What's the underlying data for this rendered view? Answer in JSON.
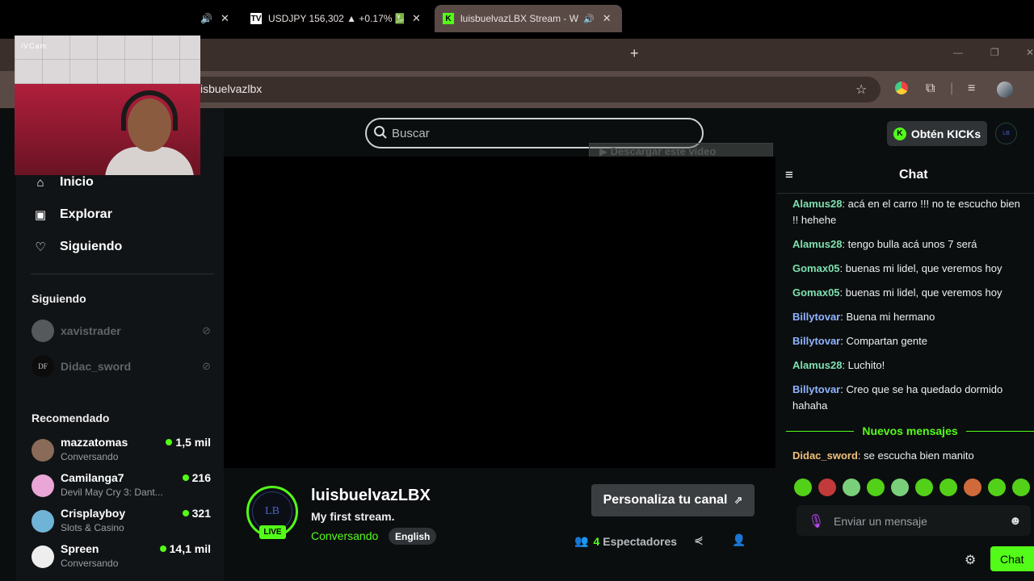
{
  "browser": {
    "tabs": [
      {
        "title": "USDJPY 156,302 ▲ +0.17% 💹",
        "favicon": "TV"
      },
      {
        "title": "luisbuelvazLBX Stream - Wa",
        "favicon": "K"
      }
    ],
    "address": "isbuelvazlbx"
  },
  "webcam": {
    "label": "iVCam"
  },
  "header": {
    "search_placeholder": "Buscar",
    "download_overlay": "▶ Descargar este video",
    "get_kicks": "Obtén KICKs"
  },
  "sidebar": {
    "nav": [
      {
        "label": "Inicio",
        "icon": "home-icon"
      },
      {
        "label": "Explorar",
        "icon": "browse-icon"
      },
      {
        "label": "Siguiendo",
        "icon": "heart-icon"
      }
    ],
    "following_title": "Siguiendo",
    "following": [
      {
        "name": "xavistrader"
      },
      {
        "name": "Didac_sword",
        "avatar_text": "DF"
      }
    ],
    "recommended_title": "Recomendado",
    "recommended": [
      {
        "name": "mazzatomas",
        "category": "Conversando",
        "viewers": "1,5 mil"
      },
      {
        "name": "Camilanga7",
        "category": "Devil May Cry 3: Dant...",
        "viewers": "216"
      },
      {
        "name": "Crisplayboy",
        "category": "Slots & Casino",
        "viewers": "321"
      },
      {
        "name": "Spreen",
        "category": "Conversando",
        "viewers": "14,1 mil"
      }
    ]
  },
  "channel": {
    "avatar_text": "LB",
    "live_badge": "LIVE",
    "name": "luisbuelvazLBX",
    "stream_title": "My first stream.",
    "category": "Conversando",
    "language": "English",
    "customize_label": "Personaliza tu canal",
    "viewer_count": "4",
    "viewers_label": "Espectadores"
  },
  "chat": {
    "title": "Chat",
    "messages": [
      {
        "user": "Alamus28",
        "text": "acá en el carro !!! no te escucho bien !! hehehe",
        "color": "#7ee0b0"
      },
      {
        "user": "Alamus28",
        "text": "tengo bulla acá unos 7 será",
        "color": "#7ee0b0"
      },
      {
        "user": "Gomax05",
        "text": "buenas mi lidel, que veremos hoy",
        "color": "#7ee0b0"
      },
      {
        "user": "Gomax05",
        "text": "buenas mi lidel, que veremos hoy",
        "color": "#7ee0b0"
      },
      {
        "user": "Billytovar",
        "text": "Buena mi hermano",
        "color": "#8fb4ff"
      },
      {
        "user": "Billytovar",
        "text": "Compartan gente",
        "color": "#8fb4ff"
      },
      {
        "user": "Alamus28",
        "text": "Luchito!",
        "color": "#7ee0b0"
      },
      {
        "user": "Billytovar",
        "text": "Creo que se ha quedado dormido hahaha",
        "color": "#8fb4ff"
      }
    ],
    "new_messages_label": "Nuevos mensajes",
    "latest": {
      "user": "Didac_sword",
      "text": "se escucha bien manito",
      "color": "#f0c07a"
    },
    "input_placeholder": "Enviar un mensaje",
    "send_label": "Chat"
  },
  "colors": {
    "accent": "#53fc18",
    "chrome": "#3b2f2c"
  }
}
